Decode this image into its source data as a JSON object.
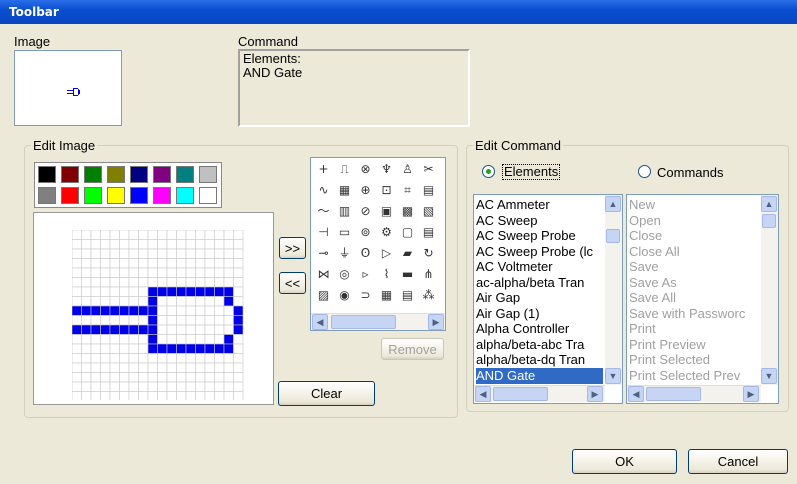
{
  "window": {
    "title": "Toolbar"
  },
  "labels": {
    "image": "Image",
    "command": "Command",
    "edit_image": "Edit Image",
    "edit_command": "Edit Command"
  },
  "command_text": {
    "line1": "Elements:",
    "line2": "AND Gate"
  },
  "buttons": {
    "add": ">>",
    "remove_arrows": "<<",
    "remove": "Remove",
    "clear": "Clear",
    "ok": "OK",
    "cancel": "Cancel"
  },
  "radios": {
    "elements": "Elements",
    "commands": "Commands",
    "selected": "elements"
  },
  "colors": {
    "title_bar": "#0a4fd0",
    "selection": "#316ac5",
    "pixel_fill": "#0000e8",
    "palette": [
      "#000000",
      "#800000",
      "#008000",
      "#808000",
      "#000080",
      "#800080",
      "#008080",
      "#c0c0c0",
      "#808080",
      "#ff0000",
      "#00ff00",
      "#ffff00",
      "#0000ff",
      "#ff00ff",
      "#00ffff",
      "#ffffff"
    ]
  },
  "icons": [
    "plus-icon",
    "switch-icon",
    "meter-icon",
    "probe-icon",
    "person-icon",
    "scissors-icon",
    "sine-icon",
    "grid-icon",
    "phase-icon",
    "box-icon",
    "plug-icon",
    "paste-icon",
    "wave-icon",
    "block-icon",
    "dial-icon",
    "board-icon",
    "chip-icon",
    "clipboard-icon",
    "cap-icon",
    "resistor-icon",
    "meter2-icon",
    "gear-icon",
    "new-file-icon",
    "notes-icon",
    "diode-icon",
    "ground-icon",
    "coil-icon",
    "gain-icon",
    "open-folder-icon",
    "undo-icon",
    "bridge-icon",
    "source-icon",
    "gate-icon",
    "spring-icon",
    "save-icon",
    "tree-icon",
    "matrix-icon",
    "gauge-icon",
    "and-gate-icon",
    "chart-icon",
    "print-icon",
    "network-icon"
  ],
  "elements": [
    "AC Ammeter",
    "AC Sweep",
    "AC Sweep Probe",
    "AC Sweep Probe (lc",
    "AC Voltmeter",
    "ac-alpha/beta Tran",
    "Air Gap",
    "Air Gap (1)",
    "Alpha Controller",
    "alpha/beta-abc Tra",
    "alpha/beta-dq Tran",
    "AND Gate"
  ],
  "selected_element": "AND Gate",
  "commands": [
    "New",
    "Open",
    "Close",
    "Close All",
    "Save",
    "Save As",
    "Save All",
    "Save with Passworc",
    "Print",
    "Print Preview",
    "Print Selected",
    "Print Selected Prev"
  ],
  "pixel_art": [
    "................",
    "................",
    "................",
    "................",
    "................",
    "................",
    "........#########.",
    "........#.......#.",
    "#########........#",
    "........#........#",
    "#########........#",
    "........#.......#.",
    "........#########.",
    "................",
    "................",
    "................",
    "................",
    "................"
  ]
}
